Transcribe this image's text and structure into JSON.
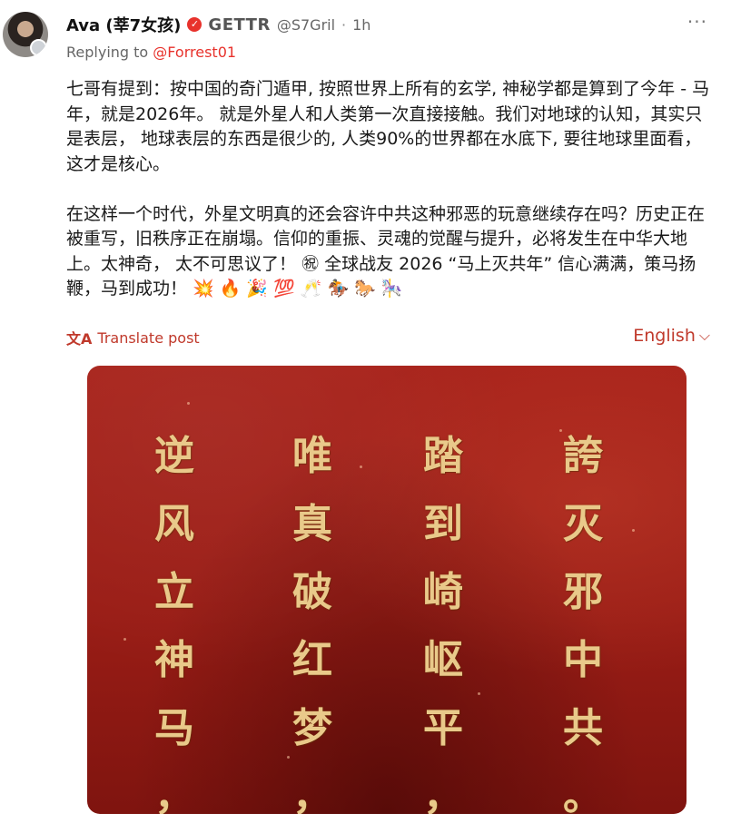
{
  "post": {
    "author_name": "Ava (莘7女孩)",
    "platform": "GETTR",
    "handle": "@S7Gril",
    "separator": "·",
    "time": "1h",
    "reply_prefix": "Replying to ",
    "reply_to": "@Forrest01",
    "text": "七哥有提到：按中国的奇门遁甲, 按照世界上所有的玄学, 神秘学都是算到了今年 - 马年，就是2026年。 就是外星人和人类第一次直接接触。我们对地球的认知，其实只是表层， 地球表层的东西是很少的, 人类90%的世界都在水底下, 要往地球里面看，这才是核心。\n\n在这样一个时代，外星文明真的还会容许中共这种邪恶的玩意继续存在吗？历史正在被重写，旧秩序正在崩塌。信仰的重振、灵魂的觉醒与提升，必将发生在中华大地上。太神奇， 太不可思议了！ ㊗ 全球战友 2026 “马上灭共年” 信心满满，策马扬鞭，马到成功！ 💥 🔥 🎉 💯 🥂 🏇 🐎 🎠",
    "translate_label": "Translate post",
    "language_label": "English",
    "more_label": "···"
  },
  "image": {
    "columns": [
      [
        "逆",
        "风",
        "立",
        "神",
        "马",
        "，"
      ],
      [
        "唯",
        "真",
        "破",
        "红",
        "梦",
        "，"
      ],
      [
        "踏",
        "到",
        "崎",
        "岖",
        "平",
        "，"
      ],
      [
        "誇",
        "灭",
        "邪",
        "中",
        "共",
        "。"
      ]
    ]
  },
  "colors": {
    "accent": "#e8322c",
    "link": "#c0392b",
    "image_bg": "#9a1d16",
    "calligraphy_gold": "#e9c98a"
  },
  "icons": {
    "verified": "check-badge-icon",
    "translate": "translate-icon",
    "language_dropdown": "chevron-down-icon",
    "more": "more-options-icon"
  }
}
